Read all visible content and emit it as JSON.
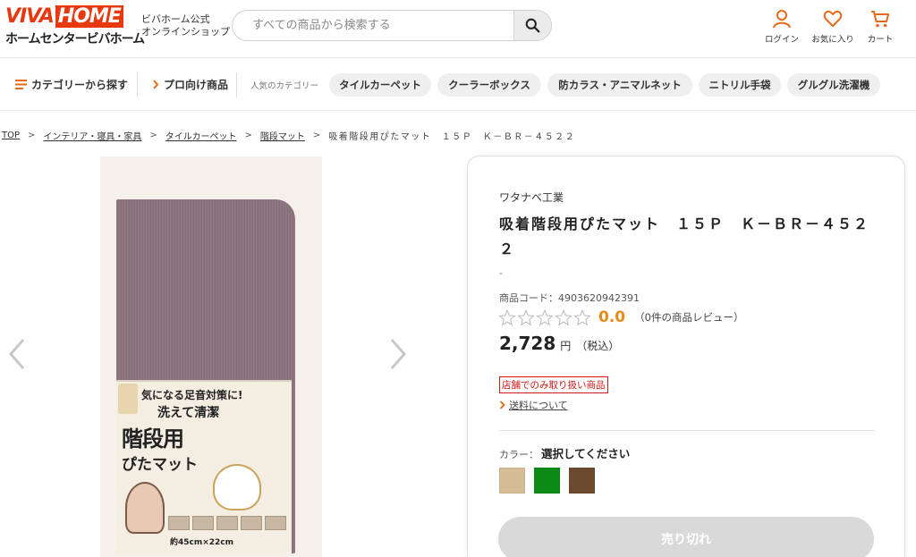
{
  "header": {
    "logo_top_a": "VIVA",
    "logo_top_b": "HOME",
    "logo_bottom": "ホームセンタービバホーム",
    "logo_sub_line1": "ビバホーム公式",
    "logo_sub_line2": "オンラインショップ",
    "search_placeholder": "すべての商品から検索する",
    "login_label": "ログイン",
    "favorites_label": "お気に入り",
    "cart_label": "カート"
  },
  "nav": {
    "category_label": "カテゴリーから探す",
    "pro_label": "プロ向け商品",
    "popular_label": "人気のカテゴリー",
    "chips": [
      "タイルカーペット",
      "クーラーボックス",
      "防カラス・アニマルネット",
      "ニトリル手袋",
      "グルグル洗濯機"
    ]
  },
  "breadcrumb": {
    "items": [
      "TOP",
      "インテリア・寝具・家具",
      "タイルカーペット",
      "階段マット"
    ],
    "current": "吸着階段用ぴたマット　１５Ｐ　Ｋ－ＢＲ－４５２２",
    "separator": ">"
  },
  "gallery": {
    "pkg_line1": "気になる足音対策に!",
    "pkg_line2": "洗えて清潔",
    "pkg_line3": "階段用",
    "pkg_line4": "ぴたマット",
    "pkg_size": "約45cm×22cm"
  },
  "product": {
    "maker": "ワタナベ工業",
    "title": "吸着階段用ぴたマット　１５Ｐ　Ｋ－ＢＲ－４５２２",
    "dash": "-",
    "code_label": "商品コード：",
    "code_value": "4903620942391",
    "rating_score": "0.0",
    "rating_value": 0,
    "rating_max": 5,
    "review_text": "（0件の商品レビュー）",
    "price": "2,728",
    "price_unit": "円",
    "price_tax": "（税込）",
    "store_only": "店舗でのみ取り扱い商品",
    "shipping_link": "送料について",
    "color_label": "カラー：",
    "color_value": "選択してください",
    "swatches": [
      "#d6bc94",
      "#0b8a16",
      "#6b4a2e"
    ],
    "soldout_label": "売り切れ"
  },
  "colors": {
    "accent": "#e8380d",
    "icon_orange": "#e86a18",
    "rating": "#e88b1c",
    "store_badge": "#d01818"
  }
}
